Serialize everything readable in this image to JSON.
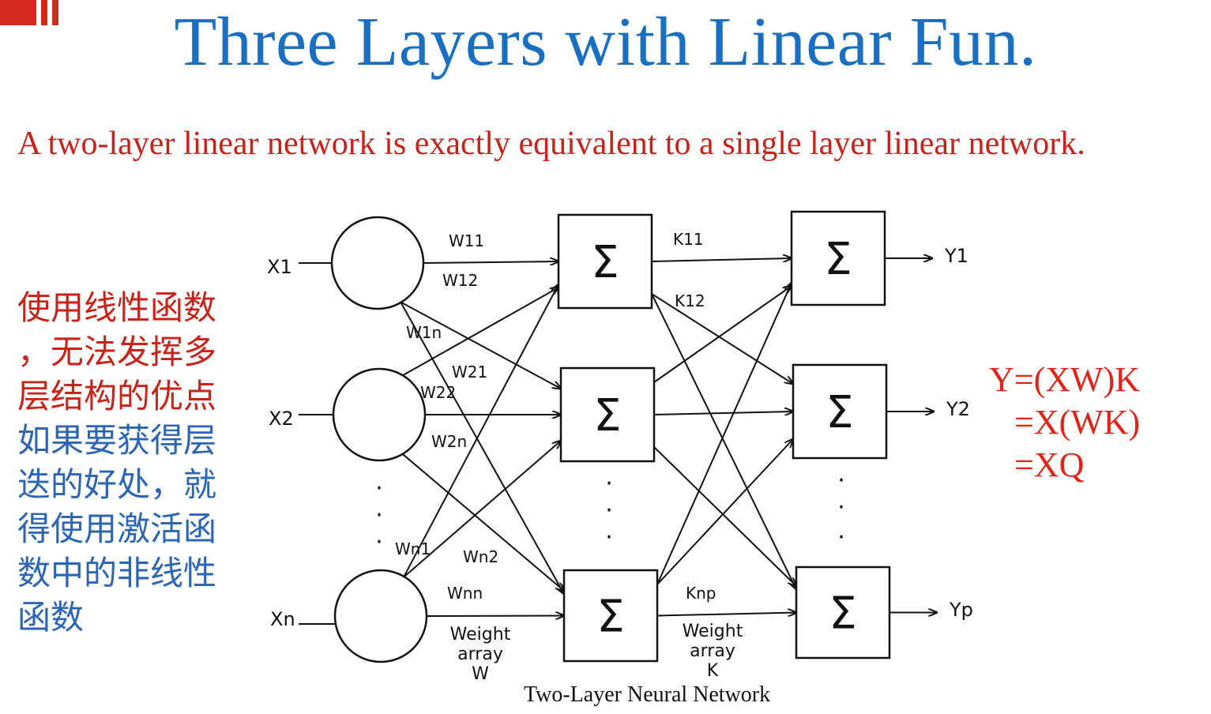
{
  "slide": {
    "title": "Three Layers with Linear Fun.",
    "subtitle": "A two-layer linear network is exactly equivalent to a single layer linear network.",
    "colors": {
      "title": "#1a6fc1",
      "subtitle": "#c8221a",
      "formula": "#e0241a",
      "note_red": "#c8221a",
      "note_blue": "#2d64b4"
    }
  },
  "side_note": {
    "lines": [
      {
        "text": "使用线性函数",
        "color": "red"
      },
      {
        "text": "，无法发挥多",
        "color": "red"
      },
      {
        "text": "层结构的优点",
        "color": "red"
      },
      {
        "text": "如果要获得层",
        "color": "blue"
      },
      {
        "text": "迭的好处，就",
        "color": "blue"
      },
      {
        "text": "得使用激活函",
        "color": "blue"
      },
      {
        "text": "数中的非线性",
        "color": "blue"
      },
      {
        "text": "函数",
        "color": "blue"
      }
    ]
  },
  "formula": {
    "line1": "Y=(XW)K",
    "line2": "=X(WK)",
    "line3": "=XQ"
  },
  "diagram": {
    "caption": "Two-Layer Neural Network",
    "input_labels": [
      "X1",
      "X2",
      "Xn"
    ],
    "output_labels": [
      "Y1",
      "Y2",
      "Yp"
    ],
    "sum_symbol": "Σ",
    "ellipsis": "·",
    "weight_labels_w": [
      "W11",
      "W12",
      "W1n",
      "W21",
      "W22",
      "W2n",
      "Wn1",
      "Wn2",
      "Wnn"
    ],
    "weight_labels_k": [
      "K11",
      "K12",
      "Knp"
    ],
    "weight_array_w": [
      "Weight",
      "array",
      "W"
    ],
    "weight_array_k": [
      "Weight",
      "array",
      "K"
    ]
  }
}
